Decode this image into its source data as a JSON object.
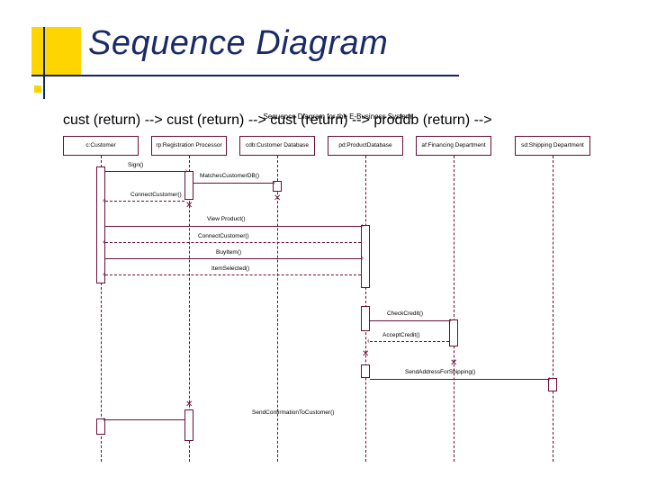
{
  "title": "Sequence Diagram",
  "diagram": {
    "caption": "Sequence Diagram for the E-Business System",
    "participants": [
      "c:Customer",
      "rp:Registration Processor",
      "cdb:Customer Database",
      "pd:ProductDatabase",
      "af:Financing Department",
      "sd:Shipping Department"
    ],
    "messages": [
      "Sign()",
      "MatchesCustomerDB()",
      "ConnectCustomer()",
      "View Product()",
      "ConnectCustomer()",
      "BuyItem()",
      "ItemSelected()",
      "CheckCredit()",
      "AcceptCredit()",
      "SendAddressForShipping()",
      "SendConfirmationToCustomer()"
    ]
  }
}
